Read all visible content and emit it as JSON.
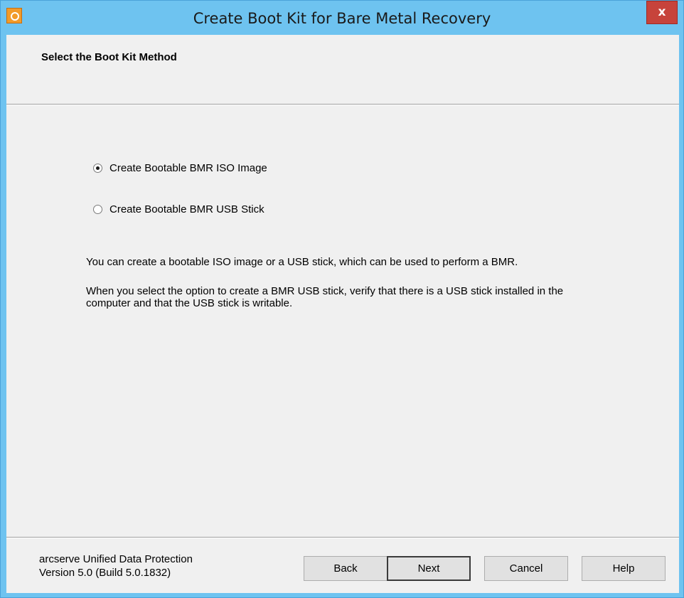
{
  "window": {
    "title": "Create Boot Kit for Bare Metal Recovery",
    "close_label": "x",
    "app_icon": "arcserve-app-icon"
  },
  "header": {
    "heading": "Select the Boot Kit Method"
  },
  "options": [
    {
      "label": "Create Bootable BMR ISO Image",
      "selected": true
    },
    {
      "label": "Create Bootable BMR USB Stick",
      "selected": false
    }
  ],
  "description": {
    "line1": "You can create a bootable ISO image or a USB stick, which can be used to perform a BMR.",
    "line2": "When you select the option to create a BMR USB stick, verify that there is a USB stick installed in the computer and that the USB stick is writable."
  },
  "footer": {
    "product": "arcserve Unified Data Protection",
    "version": "Version 5.0 (Build 5.0.1832)",
    "buttons": {
      "back": "Back",
      "next": "Next",
      "cancel": "Cancel",
      "help": "Help"
    }
  },
  "colors": {
    "titlebar": "#6ec3f0",
    "close": "#c7433b",
    "client": "#f0f0f0",
    "app_icon": "#f29b2a"
  }
}
